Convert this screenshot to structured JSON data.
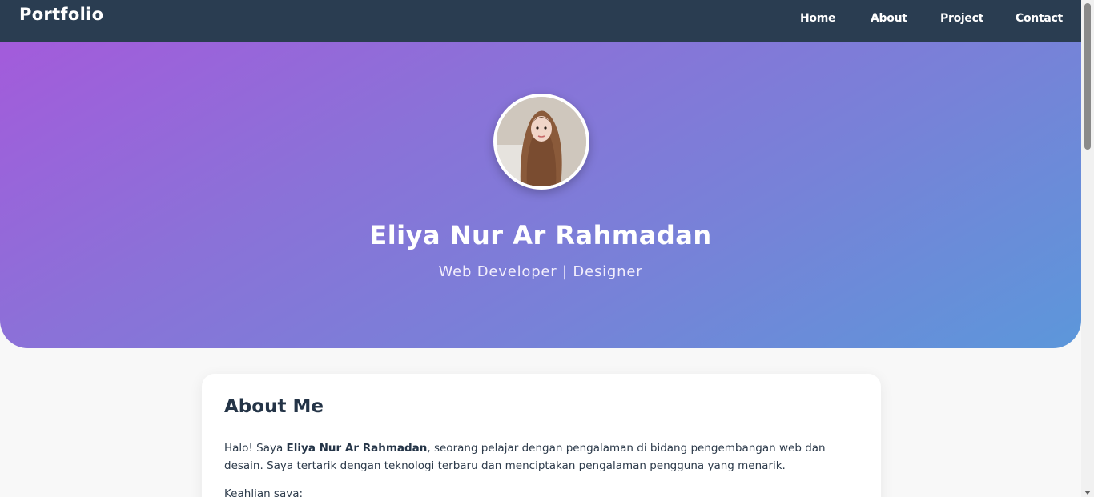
{
  "nav": {
    "brand": "Portfolio",
    "links": [
      "Home",
      "About",
      "Project",
      "Contact"
    ]
  },
  "hero": {
    "name": "Eliya Nur Ar Rahmadan",
    "subtitle": "Web Developer | Designer",
    "avatar_icon": "profile-photo"
  },
  "about": {
    "title": "About Me",
    "text_prefix": "Halo! Saya ",
    "text_name": "Eliya Nur Ar Rahmadan",
    "text_rest": ", seorang pelajar dengan pengalaman di bidang pengembangan web dan desain. Saya tertarik dengan teknologi terbaru dan menciptakan pengalaman pengguna yang menarik.",
    "skills_label": "Keahlian saya:"
  },
  "colors": {
    "navbar": "#2a3d51",
    "gradient_start": "#a35bdb",
    "gradient_end": "#5c97da",
    "page_background": "#f8f8f8"
  }
}
